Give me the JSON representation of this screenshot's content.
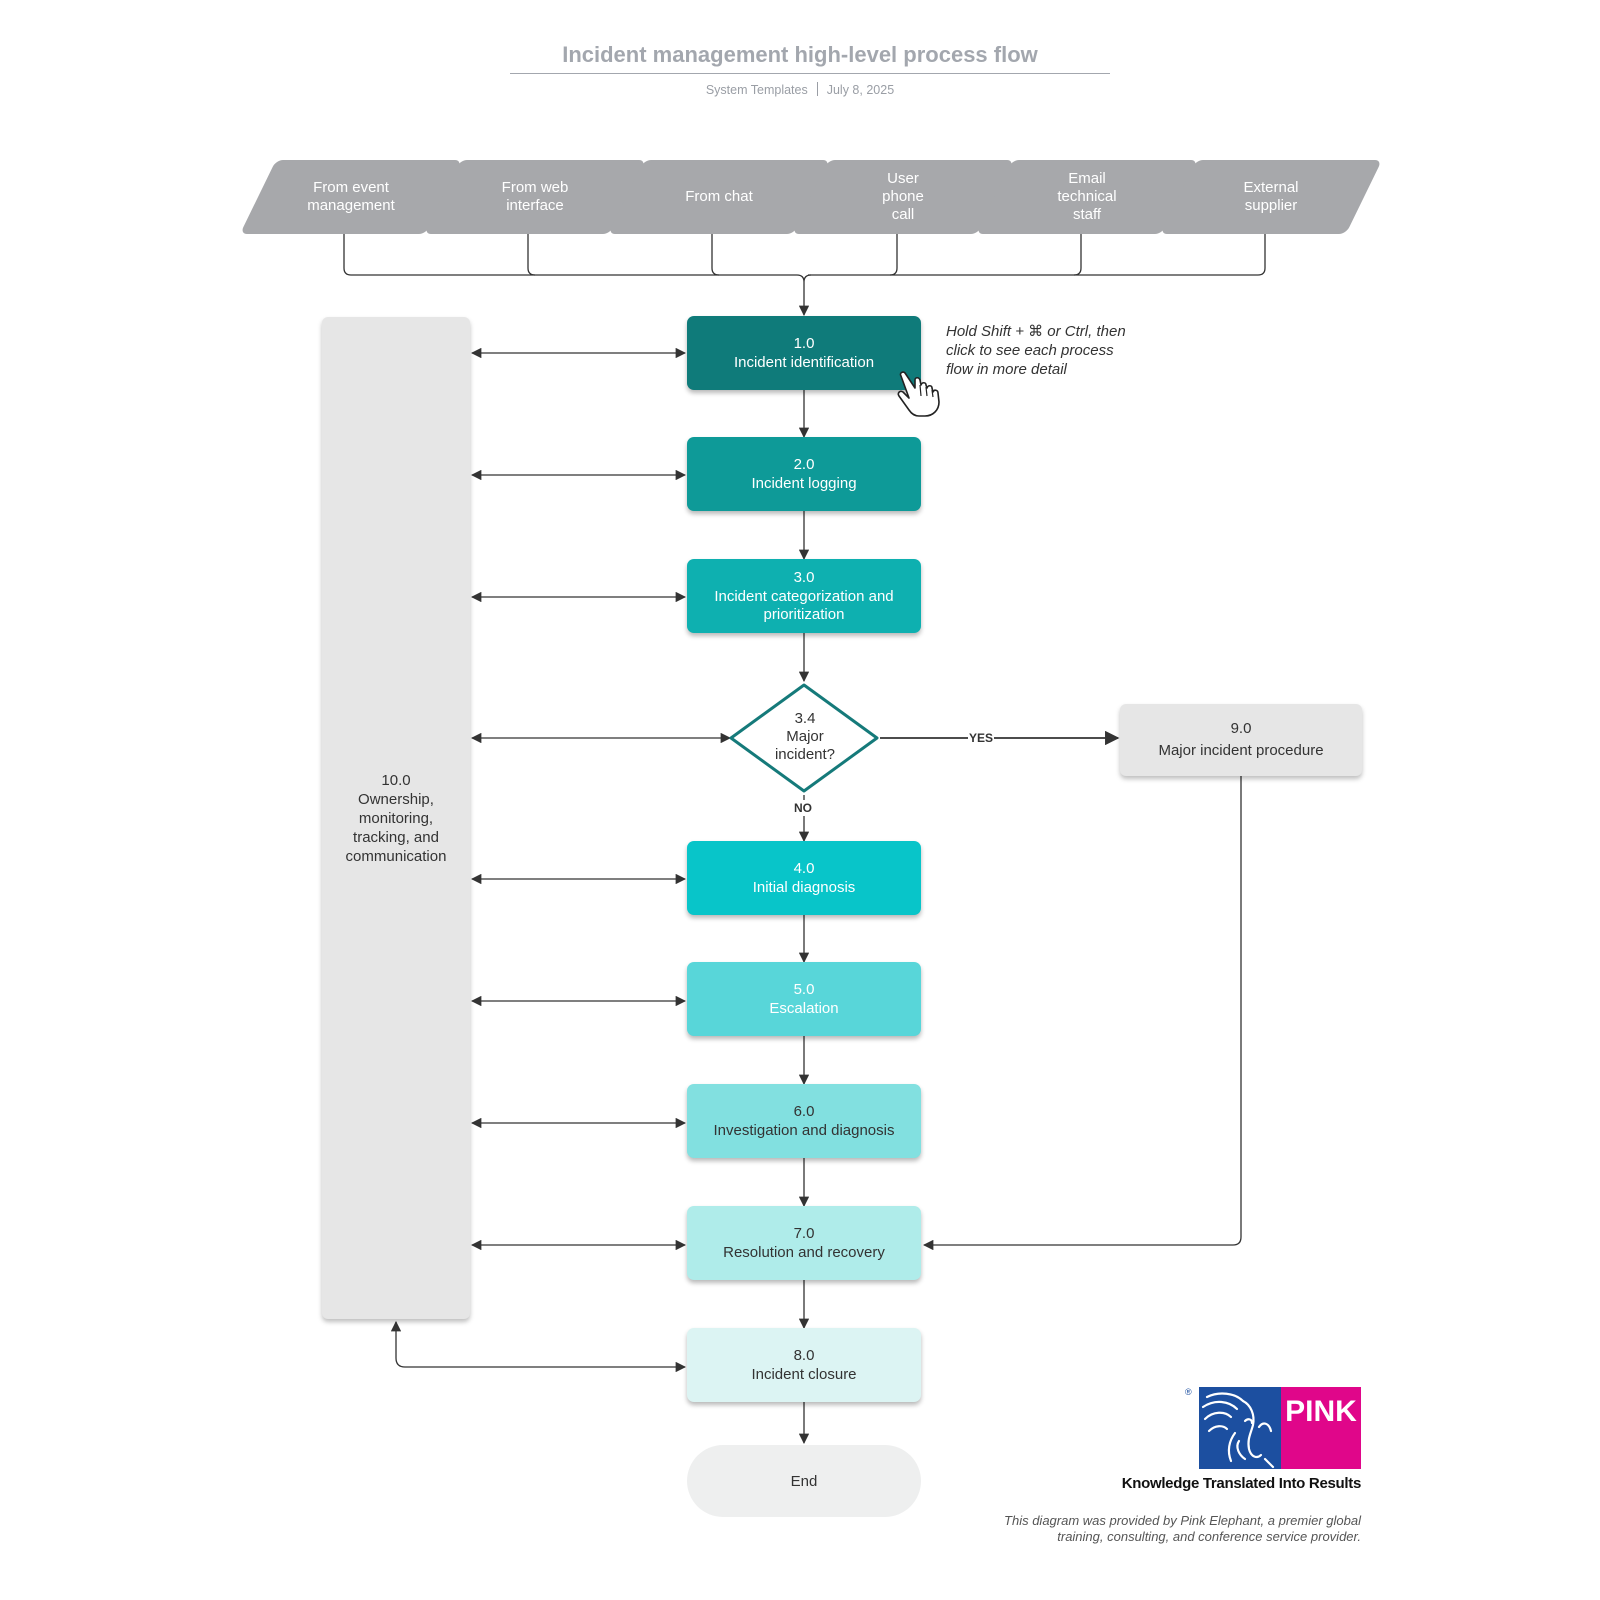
{
  "header": {
    "title": "Incident management high-level process flow",
    "author": "System Templates",
    "date": "July 8, 2025"
  },
  "inputs": [
    {
      "label": "From event\nmanagement"
    },
    {
      "label": "From web\ninterface"
    },
    {
      "label": "From chat"
    },
    {
      "label": "User\nphone\ncall"
    },
    {
      "label": "Email\ntechnical\nstaff"
    },
    {
      "label": "External\nsupplier"
    }
  ],
  "steps": [
    {
      "num": "1.0",
      "label": "Incident identification",
      "color": "#0f7b7a",
      "text_color": "#ffffff"
    },
    {
      "num": "2.0",
      "label": "Incident logging",
      "color": "#0e9a98",
      "text_color": "#ffffff"
    },
    {
      "num": "3.0",
      "label": "Incident categorization and\nprioritization",
      "color": "#0eb0b0",
      "text_color": "#ffffff"
    },
    {
      "num": "4.0",
      "label": "Initial diagnosis",
      "color": "#08c5c9",
      "text_color": "#ffffff"
    },
    {
      "num": "5.0",
      "label": "Escalation",
      "color": "#58d6d9",
      "text_color": "#ffffff"
    },
    {
      "num": "6.0",
      "label": "Investigation and diagnosis",
      "color": "#82e0e0",
      "text_color": "#333333"
    },
    {
      "num": "7.0",
      "label": "Resolution and recovery",
      "color": "#afecea",
      "text_color": "#333333"
    },
    {
      "num": "8.0",
      "label": "Incident closure",
      "color": "#dcf4f3",
      "text_color": "#333333"
    }
  ],
  "decision": {
    "text": "3.4\nMajor\nincident?",
    "border_color": "#157a7a",
    "yes_label": "YES",
    "no_label": "NO"
  },
  "major_incident": {
    "num": "9.0",
    "label": "Major incident procedure"
  },
  "ownership": {
    "text": "10.0\nOwnership,\nmonitoring,\ntracking, and\ncommunication"
  },
  "end": {
    "label": "End"
  },
  "hint": {
    "text": "Hold Shift + ⌘ or Ctrl, then\nclick to see each process\nflow in more detail"
  },
  "logo": {
    "brand": "PINK",
    "registered": "®",
    "tagline": "Knowledge Translated Into Results",
    "blue": "#1c4fa0",
    "magenta": "#e0068a"
  },
  "credit": {
    "text": "This diagram was provided by Pink Elephant, a premier global\ntraining, consulting, and conference service provider."
  }
}
